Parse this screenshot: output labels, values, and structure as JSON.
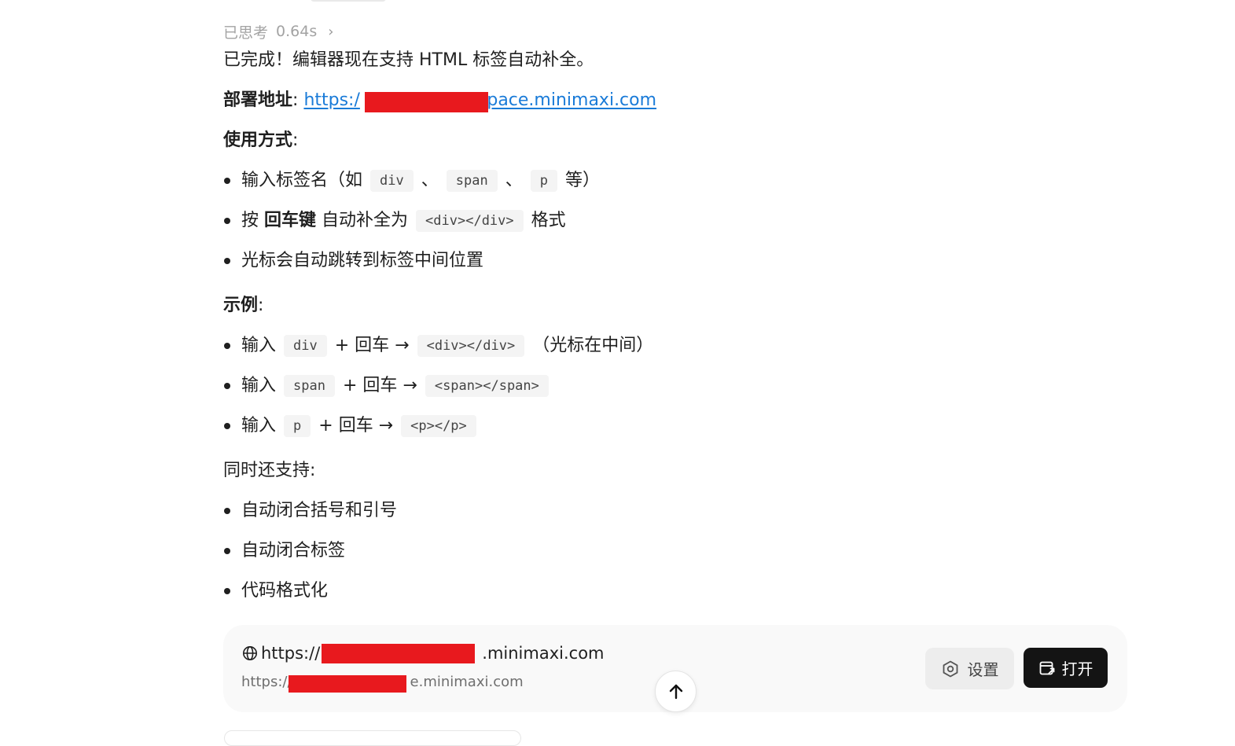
{
  "thinking": {
    "label": "已思考",
    "duration": "0.64s",
    "chevron": "›"
  },
  "message": {
    "intro": "已完成！编辑器现在支持 HTML 标签自动补全。",
    "deploy": {
      "label": "部署地址",
      "colon": ":",
      "url_prefix": "https:/",
      "url_suffix": "space.minimaxi.com"
    },
    "usage": {
      "title": "使用方式",
      "colon": ":",
      "item1": {
        "text": "输入标签名（如",
        "code1": "div",
        "sep1": "、",
        "code2": "span",
        "sep2": "、",
        "code3": "p",
        "tail": "等）"
      },
      "item2": {
        "prefix": "按",
        "bold": "回车键",
        "mid": "自动补全为",
        "code": "<div></div>",
        "tail": "格式"
      },
      "item3": {
        "text": "光标会自动跳转到标签中间位置"
      }
    },
    "examples": {
      "title": "示例",
      "colon": ":",
      "items": [
        {
          "input": "输入",
          "code": "div",
          "enter": "+ 回车 →",
          "result": "<div></div>",
          "note": "（光标在中间）"
        },
        {
          "input": "输入",
          "code": "span",
          "enter": "+ 回车 →",
          "result": "<span></span>",
          "note": ""
        },
        {
          "input": "输入",
          "code": "p",
          "enter": "+ 回车 →",
          "result": "<p></p>",
          "note": ""
        }
      ]
    },
    "also": {
      "title": "同时还支持:",
      "items": [
        "自动闭合括号和引号",
        "自动闭合标签",
        "代码格式化"
      ]
    }
  },
  "deploy_card": {
    "url_prefix": "https://",
    "url_suffix": ".minimaxi.com",
    "sub_prefix": "https://",
    "sub_suffix": "e.minimaxi.com",
    "settings_label": "设置",
    "open_label": "打开"
  },
  "icons": {
    "globe": "globe-icon",
    "settings": "settings-icon",
    "open": "open-window-icon",
    "scroll_up": "arrow-up-icon",
    "chevron": "chevron-right-icon"
  },
  "colors": {
    "link": "#1a7bd8",
    "redaction": "#e8191e",
    "open_button": "#141414"
  }
}
